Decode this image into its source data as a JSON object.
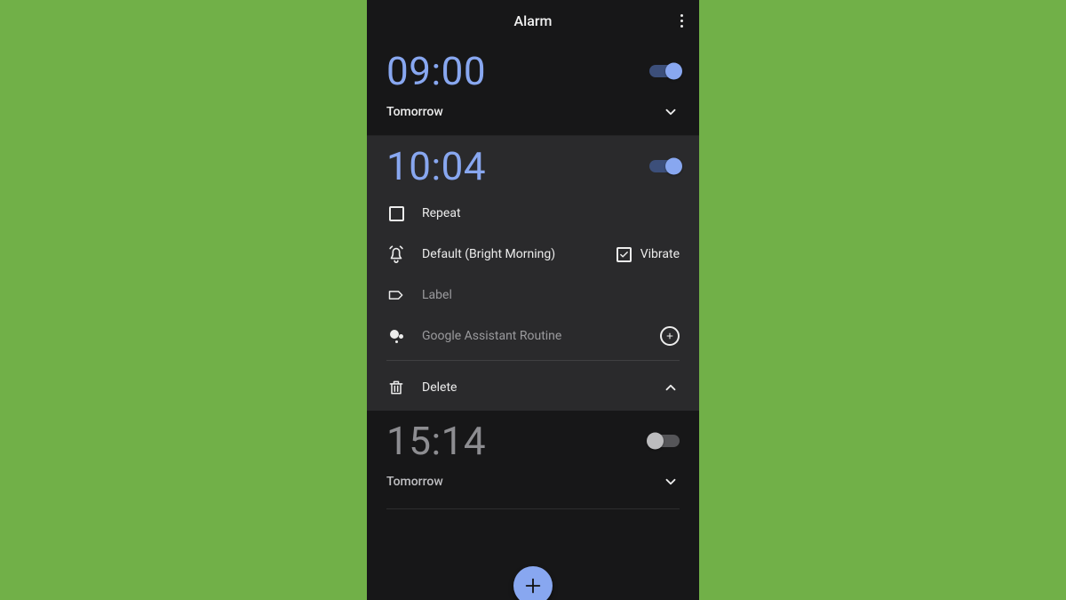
{
  "header": {
    "title": "Alarm"
  },
  "alarms": [
    {
      "time": "09:00",
      "schedule": "Tomorrow",
      "enabled": true,
      "expanded": false
    },
    {
      "time": "10:04",
      "enabled": true,
      "expanded": true,
      "repeat": {
        "label": "Repeat",
        "checked": false
      },
      "sound": {
        "label": "Default (Bright Morning)"
      },
      "vibrate": {
        "label": "Vibrate",
        "checked": true
      },
      "labelRow": {
        "label": "Label"
      },
      "assistant": {
        "label": "Google Assistant Routine"
      },
      "delete": {
        "label": "Delete"
      }
    },
    {
      "time": "15:14",
      "schedule": "Tomorrow",
      "enabled": false,
      "expanded": false
    }
  ],
  "colors": {
    "accent": "#88a7f0",
    "card_expanded_bg": "#2a2a2c",
    "page_bg": "#71b048"
  }
}
